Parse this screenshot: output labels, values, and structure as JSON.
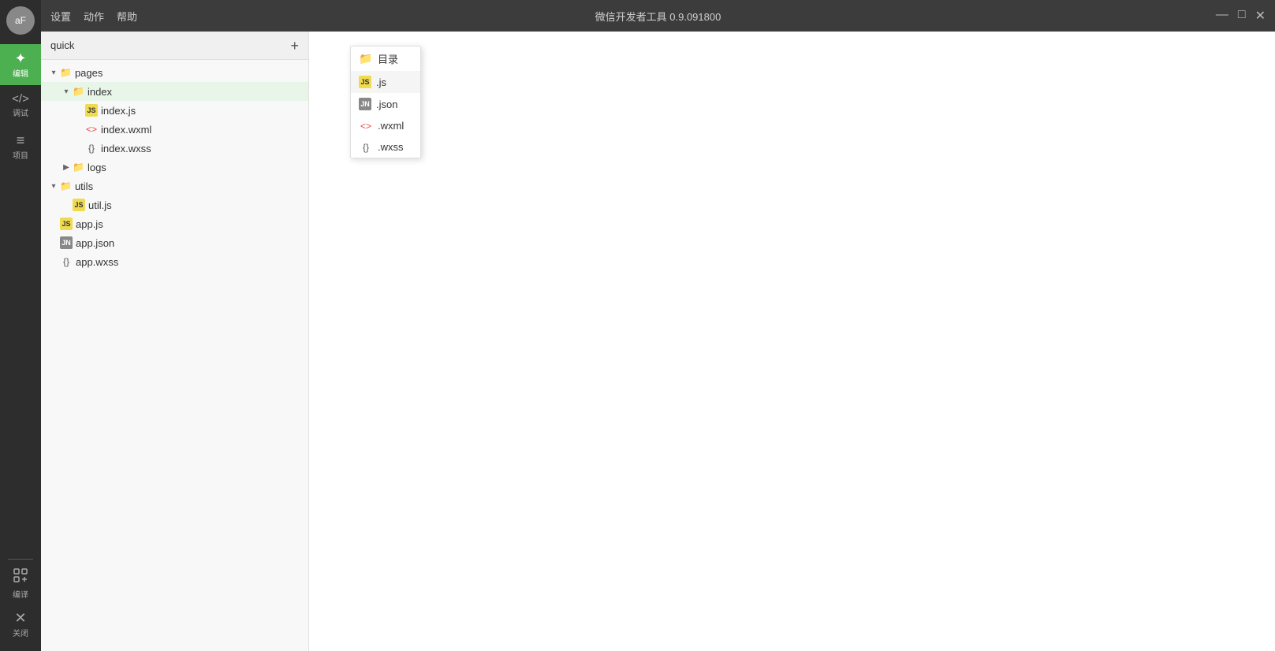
{
  "titleBar": {
    "menu": [
      "设置",
      "动作",
      "帮助"
    ],
    "title": "微信开发者工具 0.9.091800",
    "controls": {
      "minimize": "—",
      "maximize": "□",
      "close": "✕"
    }
  },
  "sidebar": {
    "avatar": "aF",
    "items": [
      {
        "id": "editor",
        "label": "编辑",
        "icon": "✦",
        "active": true
      },
      {
        "id": "debug",
        "label": "调试",
        "icon": "</>",
        "active": false
      },
      {
        "id": "project",
        "label": "项目",
        "icon": "≡",
        "active": false
      }
    ],
    "bottom": [
      {
        "id": "compile",
        "label": "编译",
        "icon": "⟳"
      },
      {
        "id": "close",
        "label": "关闭",
        "icon": "✕"
      }
    ]
  },
  "fileTree": {
    "title": "quick",
    "addButton": "+",
    "items": [
      {
        "id": "pages",
        "type": "folder",
        "name": "pages",
        "level": 0,
        "expanded": true
      },
      {
        "id": "index-folder",
        "type": "folder",
        "name": "index",
        "level": 1,
        "expanded": true
      },
      {
        "id": "index-js",
        "type": "js",
        "name": "index.js",
        "level": 2
      },
      {
        "id": "index-wxml",
        "type": "wxml",
        "name": "index.wxml",
        "level": 2
      },
      {
        "id": "index-wxss",
        "type": "wxss",
        "name": "index.wxss",
        "level": 2
      },
      {
        "id": "logs-folder",
        "type": "folder",
        "name": "logs",
        "level": 1,
        "expanded": false
      },
      {
        "id": "utils-folder",
        "type": "folder",
        "name": "utils",
        "level": 0,
        "expanded": true
      },
      {
        "id": "util-js",
        "type": "js",
        "name": "util.js",
        "level": 1
      },
      {
        "id": "app-js",
        "type": "js",
        "name": "app.js",
        "level": 0
      },
      {
        "id": "app-json",
        "type": "json",
        "name": "app.json",
        "level": 0
      },
      {
        "id": "app-wxss",
        "type": "wxss",
        "name": "app.wxss",
        "level": 0
      }
    ]
  },
  "contextMenu": {
    "items": [
      {
        "id": "directory",
        "icon": "📁",
        "label": "目录"
      },
      {
        "id": "js",
        "icon": "JS",
        "label": ".js",
        "highlighted": true
      },
      {
        "id": "json",
        "icon": "JN",
        "label": ".json"
      },
      {
        "id": "wxml",
        "icon": "<>",
        "label": ".wxml"
      },
      {
        "id": "wxss",
        "icon": "{}",
        "label": ".wxss"
      }
    ]
  }
}
